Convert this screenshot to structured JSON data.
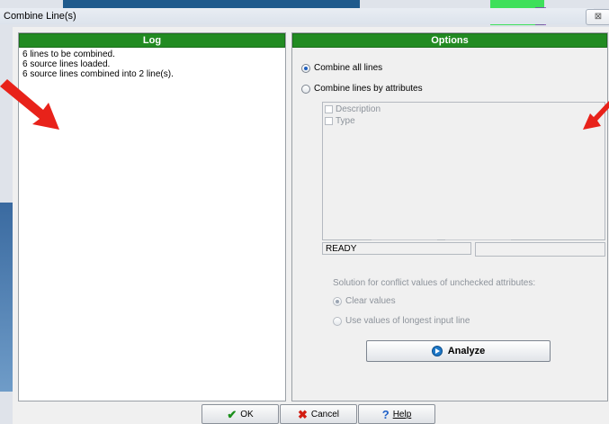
{
  "window": {
    "title": "Combine Line(s)",
    "close_glyph": "⊠"
  },
  "log": {
    "header": "Log",
    "lines": [
      "6 lines to be combined.",
      "6 source lines loaded.",
      "6 source lines combined into 2 line(s)."
    ]
  },
  "options": {
    "header": "Options",
    "mode": {
      "combine_all_label": "Combine all lines",
      "combine_all_selected": true,
      "combine_by_attr_label": "Combine lines by attributes",
      "combine_by_attr_selected": false
    },
    "attributes": [
      {
        "label": "Description",
        "checked": false
      },
      {
        "label": "Type",
        "checked": false
      }
    ],
    "status": "READY",
    "conflict": {
      "label": "Solution for conflict values of unchecked attributes:",
      "clear_label": "Clear values",
      "clear_selected": true,
      "longest_label": "Use values of longest input line",
      "longest_selected": false
    },
    "analyze_label": "Analyze"
  },
  "buttons": {
    "ok": "OK",
    "cancel": "Cancel",
    "help": "Help"
  },
  "icons": {
    "ok": "check-icon",
    "cancel": "x-icon",
    "help": "question-icon",
    "analyze": "play-circle-icon"
  },
  "colors": {
    "header_green": "#228b22",
    "annotation_arrow": "#e8221a"
  }
}
